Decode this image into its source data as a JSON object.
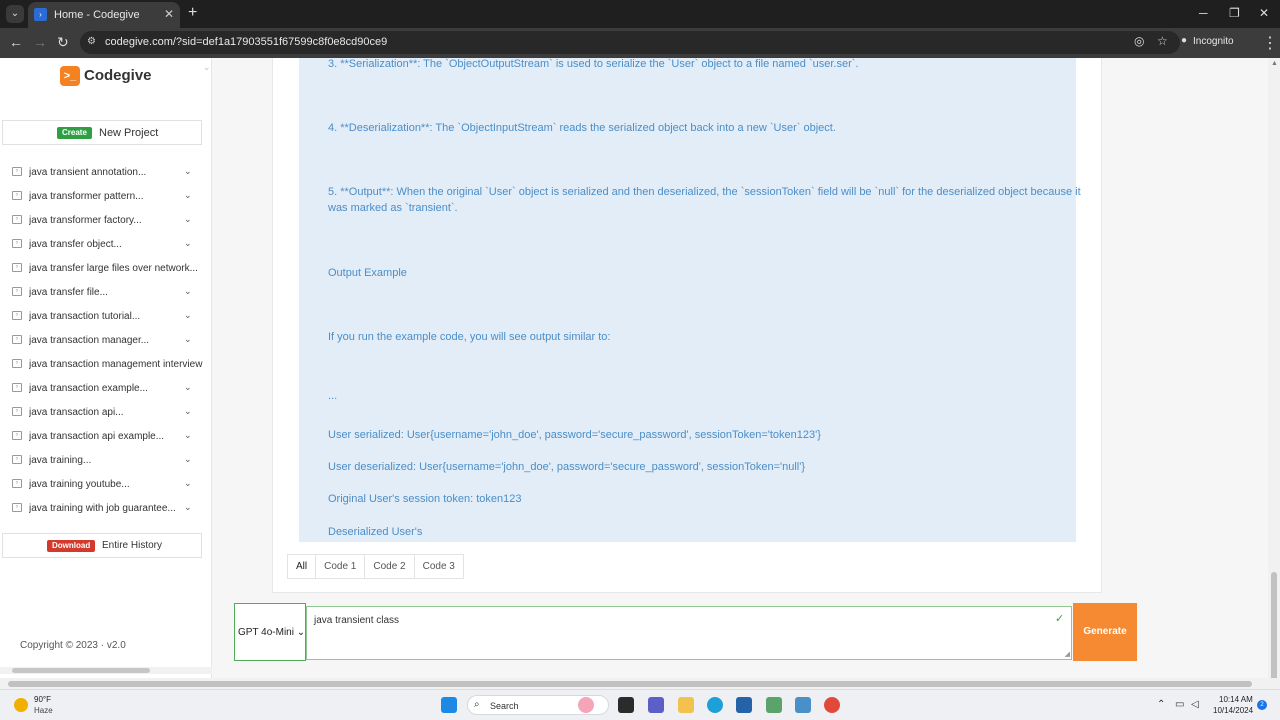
{
  "browser": {
    "tab_title": "Home - Codegive",
    "url": "codegive.com/?sid=def1a17903551f67599c8f0e8cd90ce9",
    "incognito_label": "Incognito"
  },
  "sidebar": {
    "brand": "Codegive",
    "create_badge": "Create",
    "create_label": "New Project",
    "history": [
      "java transient annotation...",
      "java transformer pattern...",
      "java transformer factory...",
      "java transfer object...",
      "java transfer large files over network...",
      "java transfer file...",
      "java transaction tutorial...",
      "java transaction manager...",
      "java transaction management interview",
      "java transaction example...",
      "java transaction api...",
      "java transaction api example...",
      "java training...",
      "java training youtube...",
      "java training with job guarantee..."
    ],
    "download_badge": "Download",
    "download_label": "Entire History",
    "copyright": "Copyright © 2023  ·  v2.0"
  },
  "content": {
    "paragraphs": [
      "3. **Serialization**: The `ObjectOutputStream` is used to serialize the `User` object to a file named `user.ser`.",
      "4. **Deserialization**: The `ObjectInputStream` reads the serialized object back into a new `User` object.",
      "5. **Output**: When the original `User` object is serialized and then deserialized, the `sessionToken` field will be `null` for the deserialized object because it was marked as `transient`.",
      "Output Example",
      "If you run the example code, you will see output similar to:",
      "...",
      "User serialized: User{username='john_doe', password='secure_password', sessionToken='token123'}",
      "User deserialized: User{username='john_doe', password='secure_password', sessionToken='null'}",
      "Original User's session token: token123",
      "Deserialized User's"
    ],
    "filter_tabs": [
      "All",
      "Code 1",
      "Code 2",
      "Code 3"
    ]
  },
  "prompt": {
    "model": "GPT 4o-Mini",
    "input_value": "java transient class",
    "generate_label": "Generate"
  },
  "taskbar": {
    "temp": "90°F",
    "condition": "Haze",
    "search_label": "Search",
    "time": "10:14 AM",
    "date": "10/14/2024",
    "notification_count": "2"
  }
}
